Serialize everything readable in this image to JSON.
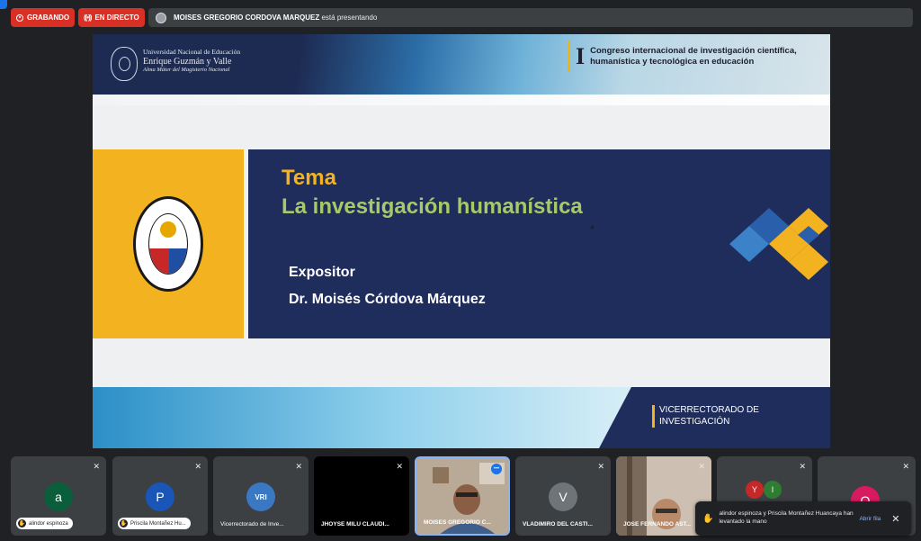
{
  "topbar": {
    "recording_label": "GRABANDO",
    "live_label": "EN DIRECTO",
    "presenter_name": "MOISES GREGORIO CORDOVA MARQUEZ",
    "presenting_suffix": "está presentando"
  },
  "slide": {
    "university_line1": "Universidad Nacional de Educación",
    "university_line2": "Enrique Guzmán y Valle",
    "university_line3": "Alma Máter del Magisterio Nacional",
    "congress_number": "I",
    "congress_line1": "Congreso internacional de investigación científica,",
    "congress_line2": "humanística y tecnológica en educación",
    "tema_label": "Tema",
    "tema_title": "La investigación humanística",
    "expositor_label": "Expositor",
    "expositor_name": "Dr. Moisés Córdova Márquez",
    "vice_line1": "VICERRECTORADO DE",
    "vice_line2": "INVESTIGACIÓN",
    "colors": {
      "navy": "#1f2d5c",
      "yellow": "#f3b320",
      "green": "#a8c96a"
    }
  },
  "participants": [
    {
      "name": "alindor espinoza",
      "initial": "a",
      "avatar_color": "#0b5e3c",
      "hand_raised": true,
      "muted": true
    },
    {
      "name": "Priscila Montañez Hu...",
      "initial": "P",
      "avatar_color": "#1a56b8",
      "hand_raised": true,
      "muted": true
    },
    {
      "name": "Vicerrectorado de Inve...",
      "initial": "VRI",
      "avatar_color": "#3a78c4",
      "hand_raised": false,
      "muted": true
    },
    {
      "name": "JHOYSE MILU CLAUDI...",
      "initial": "",
      "avatar_color": "#000000",
      "hand_raised": false,
      "muted": true
    },
    {
      "name": "MOISES GREGORIO C...",
      "initial": "",
      "avatar_color": "#6d5a48",
      "hand_raised": false,
      "muted": false
    },
    {
      "name": "VLADIMIRO DEL CASTI...",
      "initial": "V",
      "avatar_color": "#6f7478",
      "hand_raised": false,
      "muted": true
    },
    {
      "name": "JOSE FERNANDO AST...",
      "initial": "",
      "avatar_color": "#8c7a6a",
      "hand_raised": false,
      "muted": true
    },
    {
      "name": "",
      "initial": "Y I",
      "avatar_color": "#c62828",
      "hand_raised": false,
      "muted": true
    },
    {
      "name": "",
      "initial": "O",
      "avatar_color": "#d81b60",
      "hand_raised": false,
      "muted": true
    }
  ],
  "toast": {
    "text": "alindor espinoza y Priscila Montañez Huancaya han levantado la mano",
    "action": "Abrir fila",
    "close_icon": "close-icon"
  }
}
